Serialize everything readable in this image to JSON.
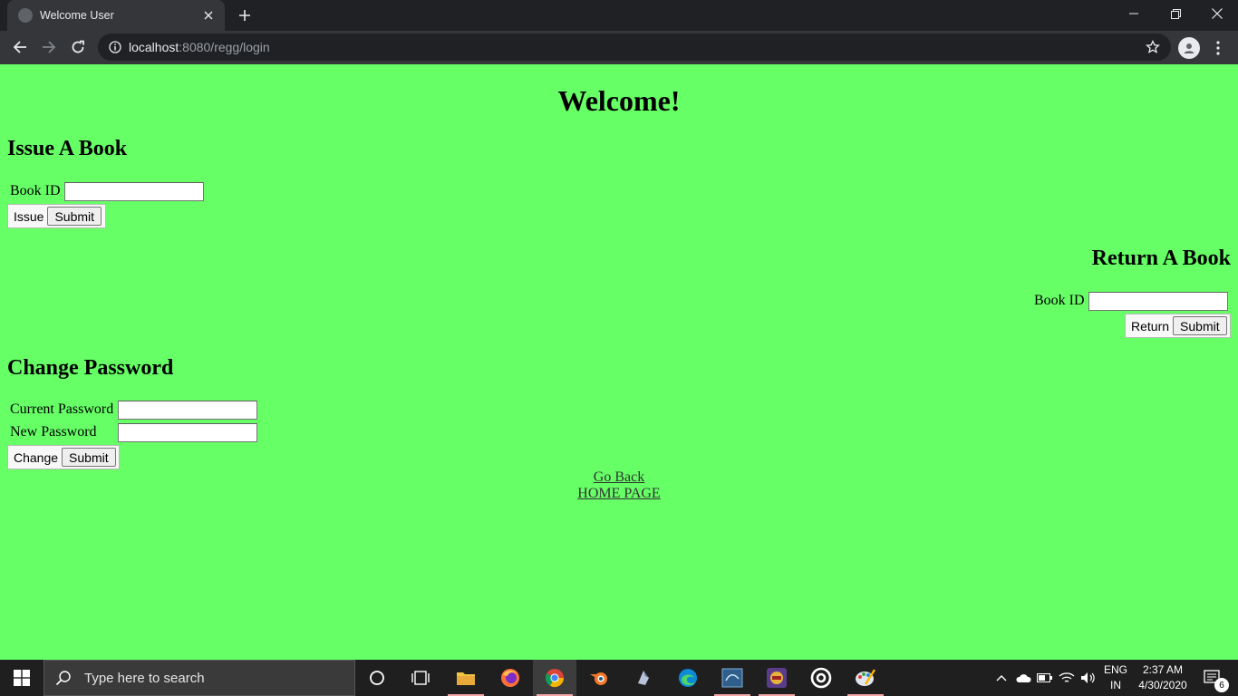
{
  "browser": {
    "tab_title": "Welcome User",
    "url_host": "localhost",
    "url_path": ":8080/regg/login"
  },
  "page": {
    "heading": "Welcome!",
    "issue": {
      "title": "Issue A Book",
      "book_id_label": "Book ID",
      "book_id_value": "",
      "group_label": "Issue",
      "submit_label": "Submit"
    },
    "return": {
      "title": "Return A Book",
      "book_id_label": "Book ID",
      "book_id_value": "",
      "group_label": "Return",
      "submit_label": "Submit"
    },
    "change_password": {
      "title": "Change Password",
      "current_label": "Current Password",
      "current_value": "",
      "new_label": "New Password",
      "new_value": "",
      "group_label": "Change",
      "submit_label": "Submit"
    },
    "links": {
      "go_back": "Go Back",
      "home_page": "HOME PAGE"
    }
  },
  "taskbar": {
    "search_placeholder": "Type here to search",
    "language": "ENG",
    "region": "IN",
    "time": "2:37 AM",
    "date": "4/30/2020",
    "notification_count": "6"
  },
  "colors": {
    "page_background": "#66ff66",
    "chrome_dark": "#202124",
    "chrome_toolbar": "#35363a"
  }
}
